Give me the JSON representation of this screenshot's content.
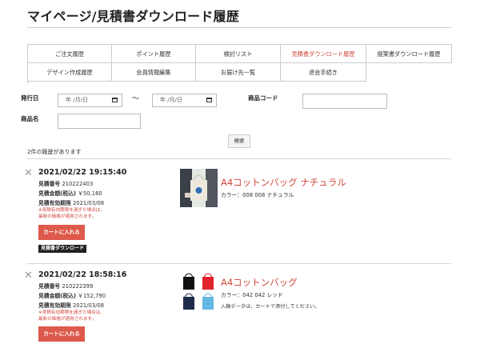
{
  "page_title": "マイページ/見積書ダウンロード履歴",
  "tabs": [
    "ご注文履歴",
    "ポイント履歴",
    "検討リスト",
    "見積書ダウンロード履歴",
    "提案書ダウンロード履歴",
    "デザイン作成履歴",
    "会員情報編集",
    "お届け先一覧",
    "退会手続き"
  ],
  "active_tab": "見積書ダウンロード履歴",
  "filter": {
    "issue_date_label": "発行日",
    "date_placeholder": "年 /月/日",
    "range_sep": "〜",
    "product_code_label": "商品コード",
    "product_name_label": "商品名",
    "search_label": "検索"
  },
  "result_count": "2件の履歴があります",
  "accent_color": "#dd5a4c",
  "items": [
    {
      "datetime": "2021/02/22 19:15:40",
      "quote_no_label": "見積番号",
      "quote_no": "210222403",
      "amount_label": "見積金額(税込)",
      "amount": "￥50,160",
      "expiry_label": "見積有効期限",
      "expiry": "2021/03/08",
      "warning_1": "※見積有効期限を過ぎた場合は、",
      "warning_2": "最新の価格が適用されます。",
      "cart_label": "カートに入れる",
      "download_label": "見積書ダウンロード",
      "product_name": "A4コットンバッグ ナチュラル",
      "product_color": "カラー：008 008 ナチュラル"
    },
    {
      "datetime": "2021/02/22 18:58:16",
      "quote_no_label": "見積番号",
      "quote_no": "210222399",
      "amount_label": "見積金額(税込)",
      "amount": "￥152,790",
      "expiry_label": "見積有効期限",
      "expiry": "2021/03/08",
      "warning_1": "※見積有効期限を過ぎた場合は、",
      "warning_2": "最新の価格が適用されます。",
      "cart_label": "カートに入れる",
      "product_name": "A4コットンバッグ",
      "product_color": "カラー：042 042 レッド",
      "note": "入稿データは、カートで添付してください。"
    }
  ]
}
